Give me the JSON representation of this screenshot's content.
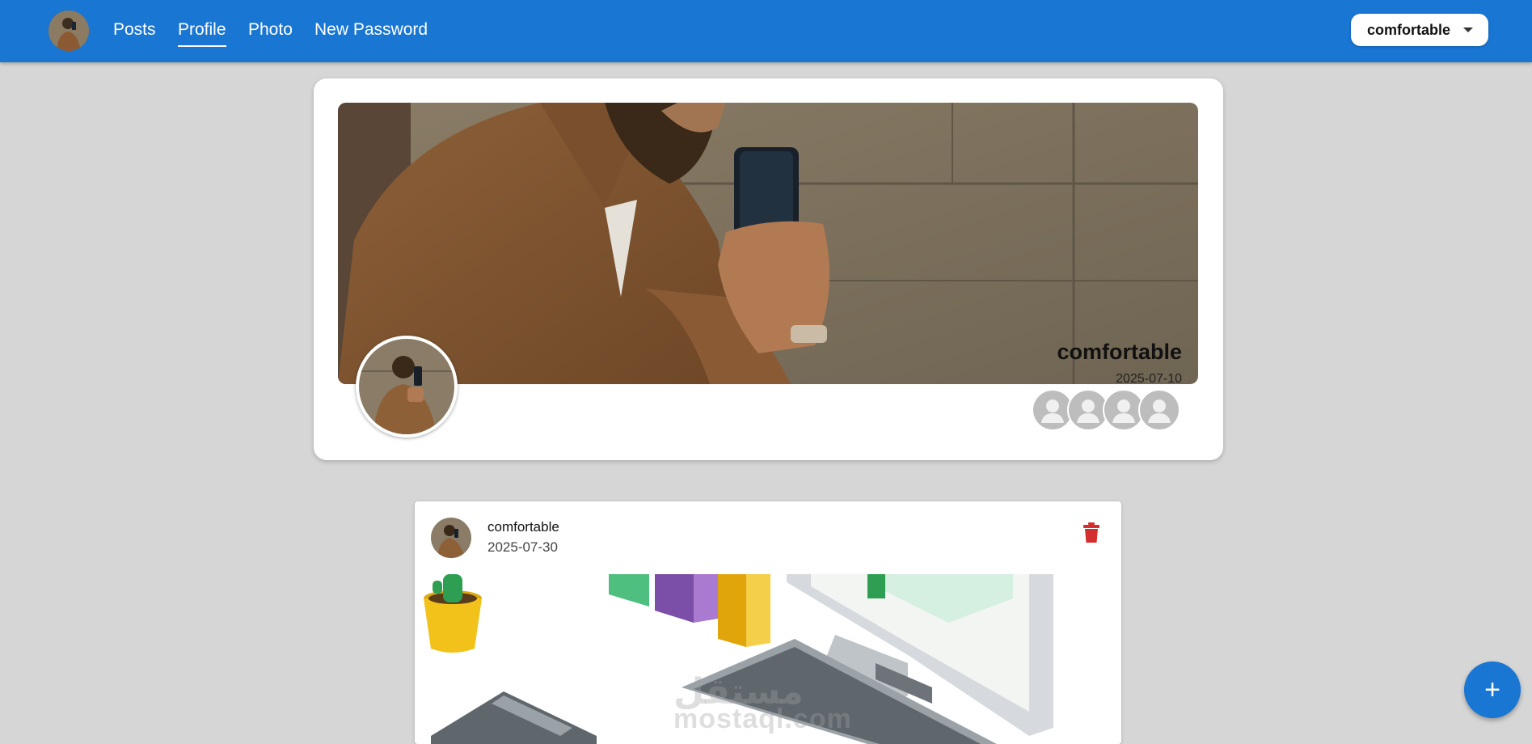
{
  "nav": {
    "links": [
      {
        "label": "Posts"
      },
      {
        "label": "Profile",
        "active": true
      },
      {
        "label": "Photo"
      },
      {
        "label": "New Password"
      }
    ],
    "user_menu": {
      "label": "comfortable"
    }
  },
  "profile": {
    "name": "comfortable",
    "date": "2025-07-10",
    "friend_count_shown": 4
  },
  "post": {
    "author": "comfortable",
    "date": "2025-07-30",
    "watermark_latin": "mostaql.com",
    "watermark_arabic": "مستقل"
  },
  "colors": {
    "primary": "#1976d2",
    "background": "#d6d6d6",
    "delete": "#d32f2f"
  },
  "icons": {
    "delete": "trash-icon",
    "fab": "plus-icon",
    "friend": "person-icon",
    "menu_caret": "caret-down-icon"
  }
}
